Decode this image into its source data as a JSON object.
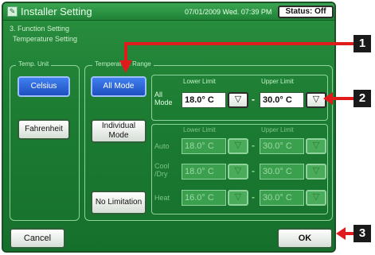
{
  "header": {
    "icon": "installer-icon",
    "title": "Installer Setting",
    "datetime": "07/01/2009 Wed. 07:39 PM",
    "status_label": "Status: Off"
  },
  "breadcrumb": {
    "level1": "3. Function Setting",
    "level2": "Temperature Setting"
  },
  "temp_unit": {
    "label": "Temp. Unit",
    "celsius": "Celsius",
    "fahrenheit": "Fahrenheit",
    "selected": "Celsius"
  },
  "temp_range": {
    "label": "Temperature Range",
    "all_mode": "All Mode",
    "individual_mode": "Individual Mode",
    "no_limitation": "No Limitation",
    "selected": "All Mode"
  },
  "all_mode_panel": {
    "lower_header": "Lower Limit",
    "upper_header": "Upper Limit",
    "row_label": "All Mode",
    "lower_value": "18.0° C",
    "upper_value": "30.0° C",
    "dash": "-"
  },
  "individual_panel": {
    "lower_header": "Lower Limit",
    "upper_header": "Upper Limit",
    "rows": [
      {
        "label": "Auto",
        "lower": "18.0° C",
        "upper": "30.0° C"
      },
      {
        "label": "Cool /Dry",
        "lower": "18.0° C",
        "upper": "30.0° C"
      },
      {
        "label": "Heat",
        "lower": "16.0° C",
        "upper": "30.0° C"
      }
    ]
  },
  "footer": {
    "cancel": "Cancel",
    "ok": "OK"
  },
  "callouts": [
    "1",
    "2",
    "3"
  ],
  "icons": {
    "down_arrow": "▽"
  },
  "colors": {
    "background": "#1d7d33",
    "selected_button": "#2f66d8",
    "callout_arrow": "#e01b1b"
  }
}
